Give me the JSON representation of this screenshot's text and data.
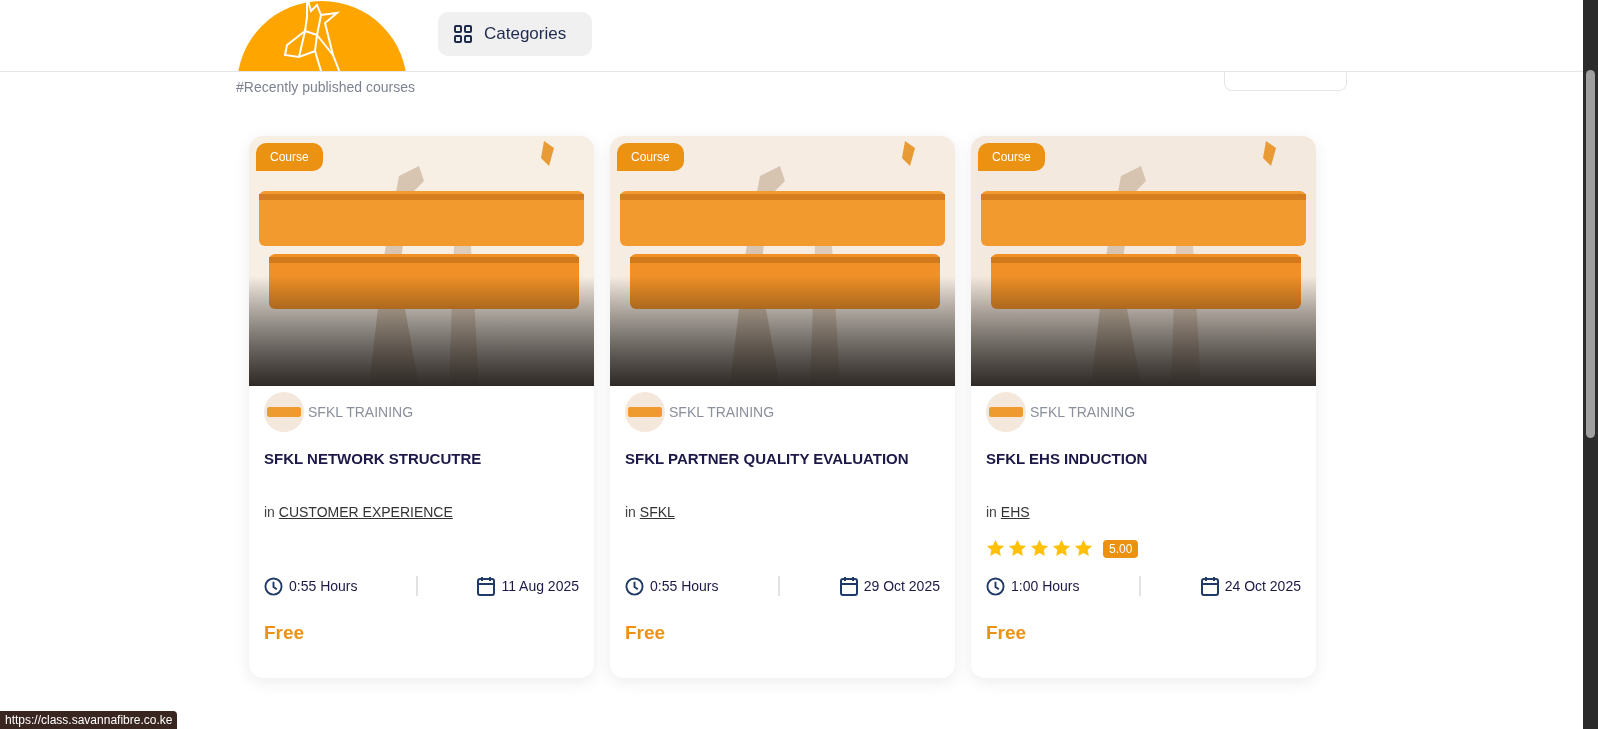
{
  "header": {
    "categories_button": "Categories"
  },
  "section": {
    "subtitle": "#Recently published courses"
  },
  "courses": [
    {
      "badge": "Course",
      "author": "SFKL TRAINING",
      "title": "SFKL NETWORK STRUCUTRE",
      "category_prefix": "in",
      "category": "CUSTOMER EXPERIENCE",
      "duration": "0:55 Hours",
      "date": "11 Aug 2025",
      "price": "Free"
    },
    {
      "badge": "Course",
      "author": "SFKL TRAINING",
      "title": "SFKL PARTNER QUALITY EVALUATION",
      "category_prefix": "in",
      "category": "SFKL",
      "duration": "0:55 Hours",
      "date": "29 Oct 2025",
      "price": "Free"
    },
    {
      "badge": "Course",
      "author": "SFKL TRAINING",
      "title": "SFKL EHS INDUCTION",
      "category_prefix": "in",
      "category": "EHS",
      "stars": 5,
      "rating": "5.00",
      "duration": "1:00 Hours",
      "date": "24 Oct 2025",
      "price": "Free"
    }
  ],
  "status_bar": {
    "url": "https://class.savannafibre.co.ke"
  }
}
